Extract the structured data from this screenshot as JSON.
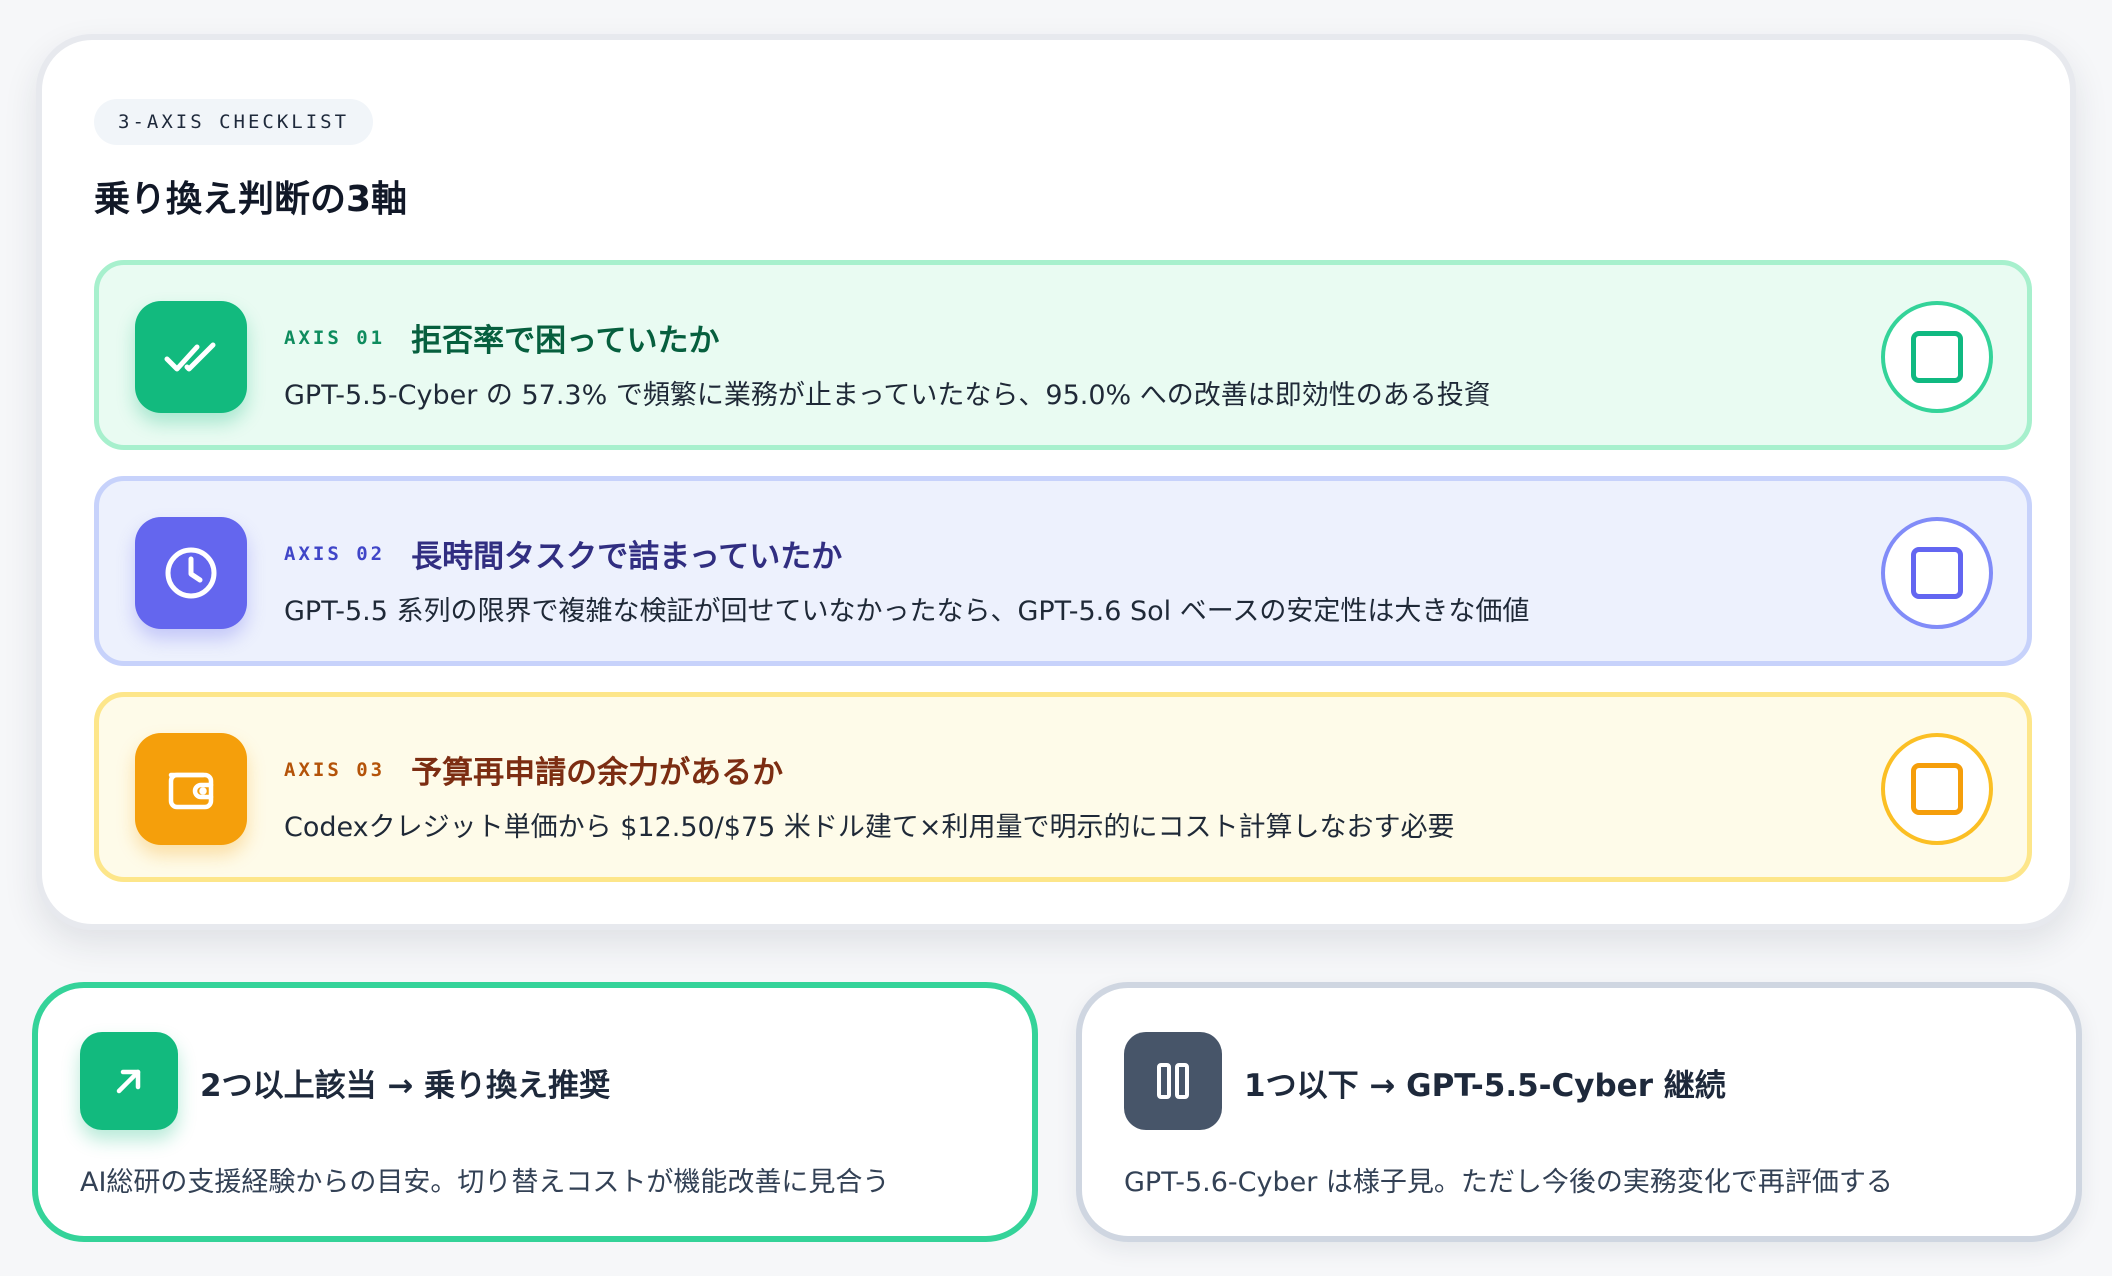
{
  "checklist": {
    "chip": "3-AXIS CHECKLIST",
    "title": "乗り換え判断の3軸",
    "axes": [
      {
        "label": "AXIS 01",
        "title": "拒否率で困っていたか",
        "desc": "GPT-5.5-Cyber の 57.3% で頻繁に業務が止まっていたなら、95.0% への改善は即効性のある投資",
        "icon": "double-check-icon",
        "color": "#12ba7e"
      },
      {
        "label": "AXIS 02",
        "title": "長時間タスクで詰まっていたか",
        "desc": "GPT-5.5 系列の限界で複雑な検証が回せていなかったなら、GPT-5.6 Sol ベースの安定性は大きな価値",
        "icon": "clock-icon",
        "color": "#6466ee"
      },
      {
        "label": "AXIS 03",
        "title": "予算再申請の余力があるか",
        "desc": "Codexクレジット単価から $12.50/$75 米ドル建て×利用量で明示的にコスト計算しなおす必要",
        "icon": "wallet-icon",
        "color": "#f59f0b"
      }
    ]
  },
  "results": [
    {
      "title": "2つ以上該当 → 乗り換え推奨",
      "desc": "AI総研の支援経験からの目安。切り替えコストが機能改善に見合う",
      "icon": "arrow-up-right-icon",
      "color": "#12ba7e"
    },
    {
      "title": "1つ以下 → GPT-5.5-Cyber 継続",
      "desc": "GPT-5.6-Cyber は様子見。ただし今後の実務変化で再評価する",
      "icon": "pause-icon",
      "color": "#475569"
    }
  ]
}
